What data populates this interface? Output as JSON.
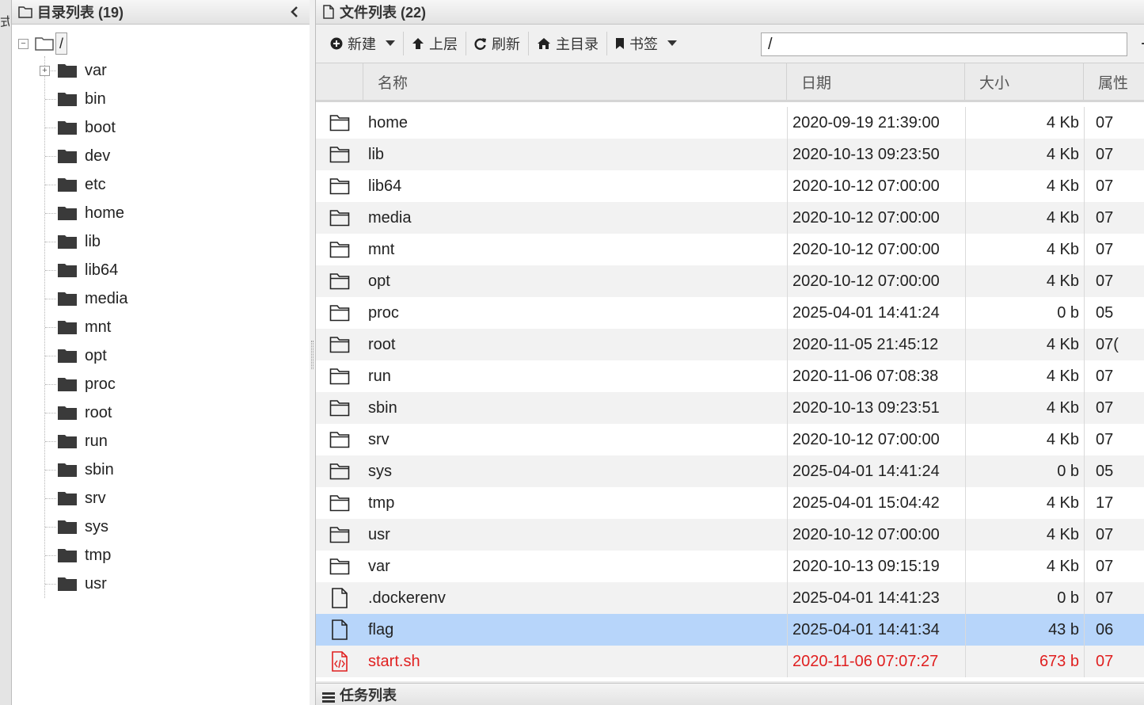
{
  "edge_char": "式",
  "dir_panel": {
    "title": "目录列表 (19)",
    "root_label": "/",
    "items": [
      {
        "label": "var",
        "expandable": true
      },
      {
        "label": "bin"
      },
      {
        "label": "boot"
      },
      {
        "label": "dev"
      },
      {
        "label": "etc"
      },
      {
        "label": "home"
      },
      {
        "label": "lib"
      },
      {
        "label": "lib64"
      },
      {
        "label": "media"
      },
      {
        "label": "mnt"
      },
      {
        "label": "opt"
      },
      {
        "label": "proc"
      },
      {
        "label": "root"
      },
      {
        "label": "run"
      },
      {
        "label": "sbin"
      },
      {
        "label": "srv"
      },
      {
        "label": "sys"
      },
      {
        "label": "tmp"
      },
      {
        "label": "usr"
      }
    ]
  },
  "file_panel": {
    "title": "文件列表 (22)",
    "toolbar": {
      "new_label": "新建",
      "up_label": "上层",
      "refresh_label": "刷新",
      "home_label": "主目录",
      "bookmark_label": "书签",
      "path_value": "/"
    },
    "columns": {
      "name": "名称",
      "date": "日期",
      "size": "大小",
      "attr": "属性"
    },
    "rows": [
      {
        "type": "folder",
        "name": "home",
        "date": "2020-09-19 21:39:00",
        "size": "4 Kb",
        "attr": "07"
      },
      {
        "type": "folder",
        "name": "lib",
        "date": "2020-10-13 09:23:50",
        "size": "4 Kb",
        "attr": "07"
      },
      {
        "type": "folder",
        "name": "lib64",
        "date": "2020-10-12 07:00:00",
        "size": "4 Kb",
        "attr": "07"
      },
      {
        "type": "folder",
        "name": "media",
        "date": "2020-10-12 07:00:00",
        "size": "4 Kb",
        "attr": "07"
      },
      {
        "type": "folder",
        "name": "mnt",
        "date": "2020-10-12 07:00:00",
        "size": "4 Kb",
        "attr": "07"
      },
      {
        "type": "folder",
        "name": "opt",
        "date": "2020-10-12 07:00:00",
        "size": "4 Kb",
        "attr": "07"
      },
      {
        "type": "folder",
        "name": "proc",
        "date": "2025-04-01 14:41:24",
        "size": "0 b",
        "attr": "05"
      },
      {
        "type": "folder",
        "name": "root",
        "date": "2020-11-05 21:45:12",
        "size": "4 Kb",
        "attr": "07("
      },
      {
        "type": "folder",
        "name": "run",
        "date": "2020-11-06 07:08:38",
        "size": "4 Kb",
        "attr": "07"
      },
      {
        "type": "folder",
        "name": "sbin",
        "date": "2020-10-13 09:23:51",
        "size": "4 Kb",
        "attr": "07"
      },
      {
        "type": "folder",
        "name": "srv",
        "date": "2020-10-12 07:00:00",
        "size": "4 Kb",
        "attr": "07"
      },
      {
        "type": "folder",
        "name": "sys",
        "date": "2025-04-01 14:41:24",
        "size": "0 b",
        "attr": "05"
      },
      {
        "type": "folder",
        "name": "tmp",
        "date": "2025-04-01 15:04:42",
        "size": "4 Kb",
        "attr": "17"
      },
      {
        "type": "folder",
        "name": "usr",
        "date": "2020-10-12 07:00:00",
        "size": "4 Kb",
        "attr": "07"
      },
      {
        "type": "folder",
        "name": "var",
        "date": "2020-10-13 09:15:19",
        "size": "4 Kb",
        "attr": "07"
      },
      {
        "type": "file",
        "name": ".dockerenv",
        "date": "2025-04-01 14:41:23",
        "size": "0 b",
        "attr": "07"
      },
      {
        "type": "file",
        "name": "flag",
        "date": "2025-04-01 14:41:34",
        "size": "43 b",
        "attr": "06",
        "selected": true
      },
      {
        "type": "script",
        "name": "start.sh",
        "date": "2020-11-06 07:07:27",
        "size": "673 b",
        "attr": "07",
        "highlight": "red"
      }
    ]
  },
  "task_bar": {
    "title": "任务列表"
  },
  "colors": {
    "selected_row": "#b7d5fa",
    "script_text": "#e02020",
    "folder_icon": "#3a3a3a"
  }
}
